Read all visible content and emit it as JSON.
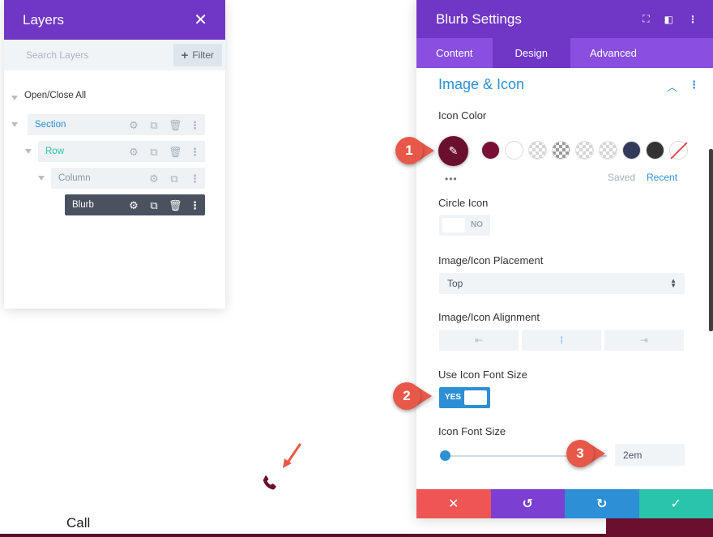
{
  "layers": {
    "title": "Layers",
    "close_glyph": "✕",
    "search_placeholder": "Search Layers",
    "filter_label": "Filter",
    "open_close_all": "Open/Close All",
    "nodes": [
      {
        "label": "Section"
      },
      {
        "label": "Row"
      },
      {
        "label": "Column"
      },
      {
        "label": "Blurb"
      }
    ]
  },
  "settings": {
    "title": "Blurb Settings",
    "tabs": [
      "Content",
      "Design",
      "Advanced"
    ],
    "active_tab": "Design",
    "section_title": "Image & Icon",
    "icon_color_label": "Icon Color",
    "selected_color": "#6b0f2f",
    "swatches": [
      "#7a0f35",
      "#ffffff",
      "checker",
      "checker-dark",
      "checker",
      "checker",
      "#343a5a",
      "#333333",
      "none"
    ],
    "saved_label": "Saved",
    "recent_label": "Recent",
    "circle_icon_label": "Circle Icon",
    "circle_icon_value": "NO",
    "placement_label": "Image/Icon Placement",
    "placement_value": "Top",
    "alignment_label": "Image/Icon Alignment",
    "alignment_value": "center",
    "use_font_size_label": "Use Icon Font Size",
    "use_font_size_value": "YES",
    "font_size_label": "Icon Font Size",
    "font_size_value": "2em",
    "footer_colors": [
      "#ef5555",
      "#7b3fd1",
      "#2d8fd5",
      "#29c4a9"
    ]
  },
  "callouts": [
    "1",
    "2",
    "3"
  ],
  "page": {
    "blurb_text": "Call",
    "icon_color": "#6b0f2f"
  }
}
